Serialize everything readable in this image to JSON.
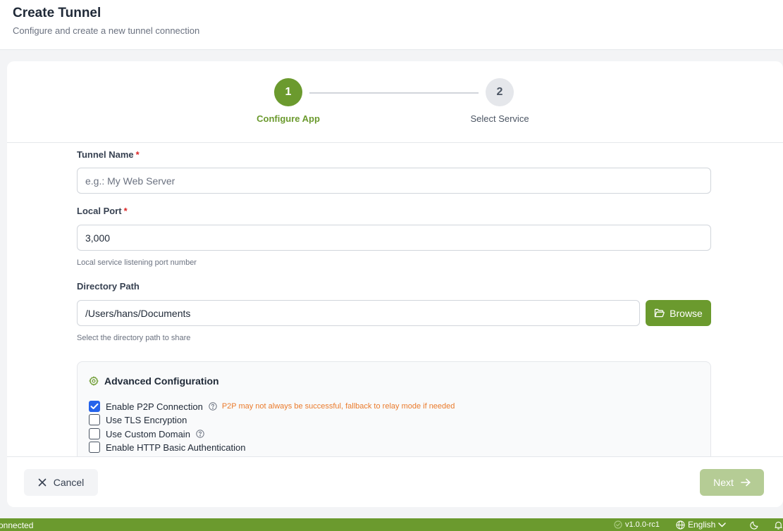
{
  "header": {
    "title": "Create Tunnel",
    "subtitle": "Configure and create a new tunnel connection"
  },
  "stepper": {
    "steps": [
      {
        "number": "1",
        "label": "Configure App",
        "state": "active"
      },
      {
        "number": "2",
        "label": "Select Service",
        "state": "inactive"
      }
    ]
  },
  "form": {
    "tunnel_name": {
      "label": "Tunnel Name",
      "required": "*",
      "placeholder": "e.g.: My Web Server",
      "value": ""
    },
    "local_port": {
      "label": "Local Port",
      "required": "*",
      "value": "3,000",
      "help": "Local service listening port number"
    },
    "directory_path": {
      "label": "Directory Path",
      "value": "/Users/hans/Documents",
      "help": "Select the directory path to share",
      "browse_label": "Browse"
    }
  },
  "advanced": {
    "title": "Advanced Configuration",
    "options": [
      {
        "label": "Enable P2P Connection",
        "checked": true,
        "help_icon": "question-circle-icon",
        "note": "P2P may not always be successful, fallback to relay mode if needed"
      },
      {
        "label": "Use TLS Encryption",
        "checked": false
      },
      {
        "label": "Use Custom Domain",
        "checked": false,
        "help_icon": "question-circle-icon"
      },
      {
        "label": "Enable HTTP Basic Authentication",
        "checked": false
      }
    ]
  },
  "footer": {
    "cancel_label": "Cancel",
    "next_label": "Next"
  },
  "status_bar": {
    "connection": "onnected",
    "version": "v1.0.0-rc1",
    "language": "English"
  },
  "colors": {
    "accent": "#6b9a2e",
    "accent_disabled": "#b5cc95",
    "checkbox_checked": "#2563eb",
    "warning": "#ea7b2c",
    "required": "#dc2626"
  }
}
